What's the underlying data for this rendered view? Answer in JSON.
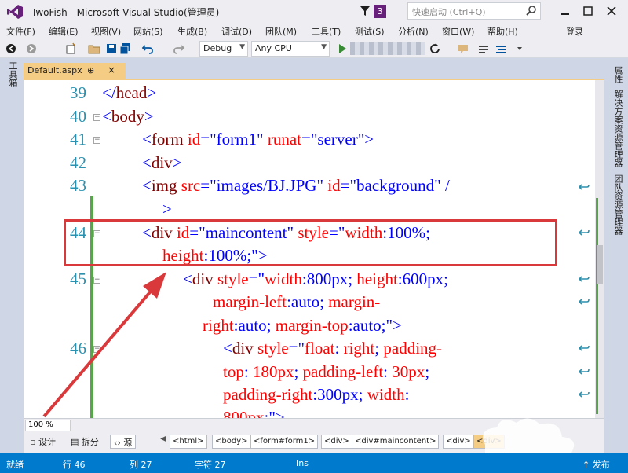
{
  "window": {
    "title": "TwoFish - Microsoft Visual Studio(管理员)",
    "notification_count": "3",
    "quick_launch_placeholder": "快速启动 (Ctrl+Q)"
  },
  "menu": {
    "items": [
      "文件(F)",
      "编辑(E)",
      "视图(V)",
      "网站(S)",
      "生成(B)",
      "调试(D)",
      "团队(M)",
      "工具(T)",
      "测试(S)",
      "分析(N)",
      "窗口(W)",
      "帮助(H)"
    ],
    "login": "登录"
  },
  "toolbar": {
    "configuration": "Debug",
    "platform": "Any CPU"
  },
  "left_strip": {
    "toolbox_tab": "工具箱"
  },
  "right_strip": {
    "tabs": [
      "属性",
      "解决方案资源管理器",
      "团队资源管理器"
    ]
  },
  "document_tab": {
    "name": "Default.aspx",
    "pin": "⊕",
    "close": "×"
  },
  "editor": {
    "line_numbers": [
      "39",
      "40",
      "41",
      "42",
      "43",
      "44",
      "45",
      "46"
    ]
  },
  "bottombar": {
    "zoom": "100 %",
    "views": [
      "设计",
      "拆分",
      "源"
    ],
    "breadcrumbs": [
      "<html>",
      "<body>",
      "<form#form1>",
      "<div>",
      "<div#maincontent>",
      "<div>",
      "<div>"
    ]
  },
  "status": {
    "ready": "就绪",
    "line": "行 46",
    "column": "列 27",
    "char": "字符 27",
    "ins": "Ins",
    "publish": "↑ 发布"
  },
  "colors": {
    "accent": "#007acc",
    "highlight_box": "#d9393b",
    "tag": "#800000",
    "attribute": "#ff0000",
    "value": "#0000ff",
    "line_number": "#2b91af",
    "tab_active": "#f5cc84"
  }
}
